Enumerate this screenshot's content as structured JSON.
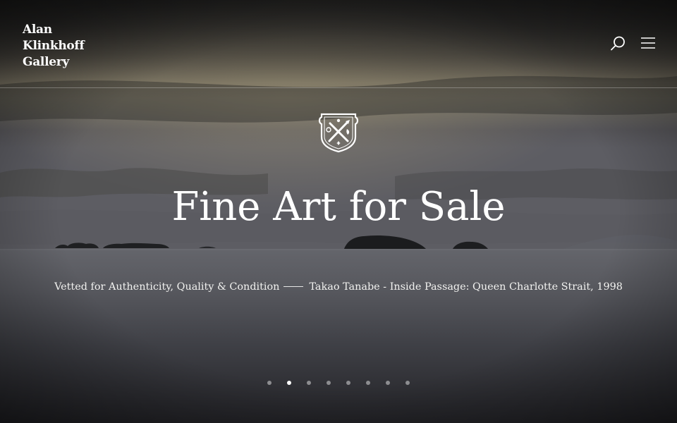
{
  "brand": {
    "line1": "Alan",
    "line2": "Klinkhoff",
    "line3": "Gallery"
  },
  "header": {
    "search_icon": "search-icon",
    "menu_icon": "hamburger-menu-icon"
  },
  "hero": {
    "crest_icon": "gallery-crest-icon",
    "title": "Fine Art for Sale",
    "tagline": "Vetted for Authenticity, Quality & Condition",
    "artwork_credit": "Takao Tanabe - Inside Passage: Queen Charlotte Strait, 1998"
  },
  "carousel": {
    "slide_count": 8,
    "active_index": 1
  },
  "colors": {
    "text": "#ffffff",
    "background": "#1e1e20"
  }
}
